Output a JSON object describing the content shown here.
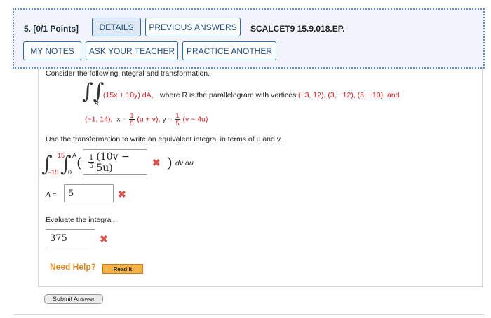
{
  "header": {
    "question_label": "5. [0/1 Points]",
    "details_label": "DETAILS",
    "previous_answers_label": "PREVIOUS ANSWERS",
    "problem_code": "SCALCET9 15.9.018.EP.",
    "my_notes_label": "MY NOTES",
    "ask_teacher_label": "ASK YOUR TEACHER",
    "practice_another_label": "PRACTICE ANOTHER"
  },
  "problem": {
    "intro": "Consider the following integral and transformation.",
    "integrand": "(15x + 10y) dA,",
    "region_text": "where R is the parallelogram with vertices",
    "vertices": "(−3, 12), (3, −12), (5, −10), and",
    "vertex4": "(−1, 14);",
    "x_eq_prefix": "x =",
    "x_frac_num": "1",
    "x_frac_den": "5",
    "x_eq_suffix": "(u + v),",
    "y_eq_prefix": "y =",
    "y_frac_num": "1",
    "y_frac_den": "5",
    "y_eq_suffix": "(v − 4u)",
    "region_letter": "R",
    "instruction": "Use the transformation to write an equivalent integral in terms of u and v.",
    "outer_upper": "15",
    "outer_lower": "−15",
    "inner_upper": "A",
    "inner_lower": "0",
    "open_paren": "(",
    "close_paren": ")",
    "differentials": "dv du",
    "answer1_frac_num": "1",
    "answer1_frac_den": "5",
    "answer1_expr": "(10v − 5u)",
    "a_label": "A =",
    "a_value": "5",
    "evaluate_text": "Evaluate the integral.",
    "answer2_value": "375",
    "incorrect_mark": "✖"
  },
  "help": {
    "need_help_label": "Need Help?",
    "read_it_label": "Read It"
  },
  "submit_label": "Submit Answer",
  "colors": {
    "accent": "#2f6aa8",
    "header_bg": "#f1f5fb",
    "error": "#d9534f",
    "help_orange": "#e08a1e",
    "read_it_bg": "#f5b347"
  }
}
